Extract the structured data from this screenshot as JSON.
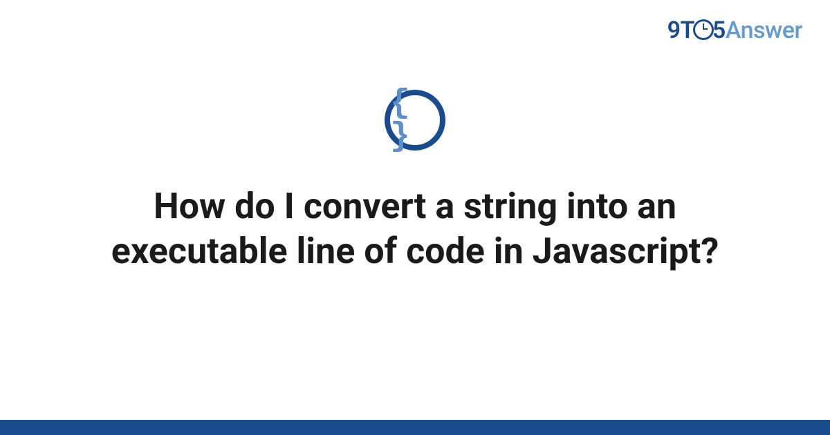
{
  "logo": {
    "part1": "9T",
    "part2": "5",
    "part3": "Answer"
  },
  "icon": {
    "symbol": "{ }",
    "name": "code-braces"
  },
  "question": {
    "title": "How do I convert a string into an executable line of code in Javascript?"
  },
  "colors": {
    "brand_dark": "#1a4b8c",
    "brand_light": "#6699cc",
    "icon_fill": "#5b8fc7"
  }
}
